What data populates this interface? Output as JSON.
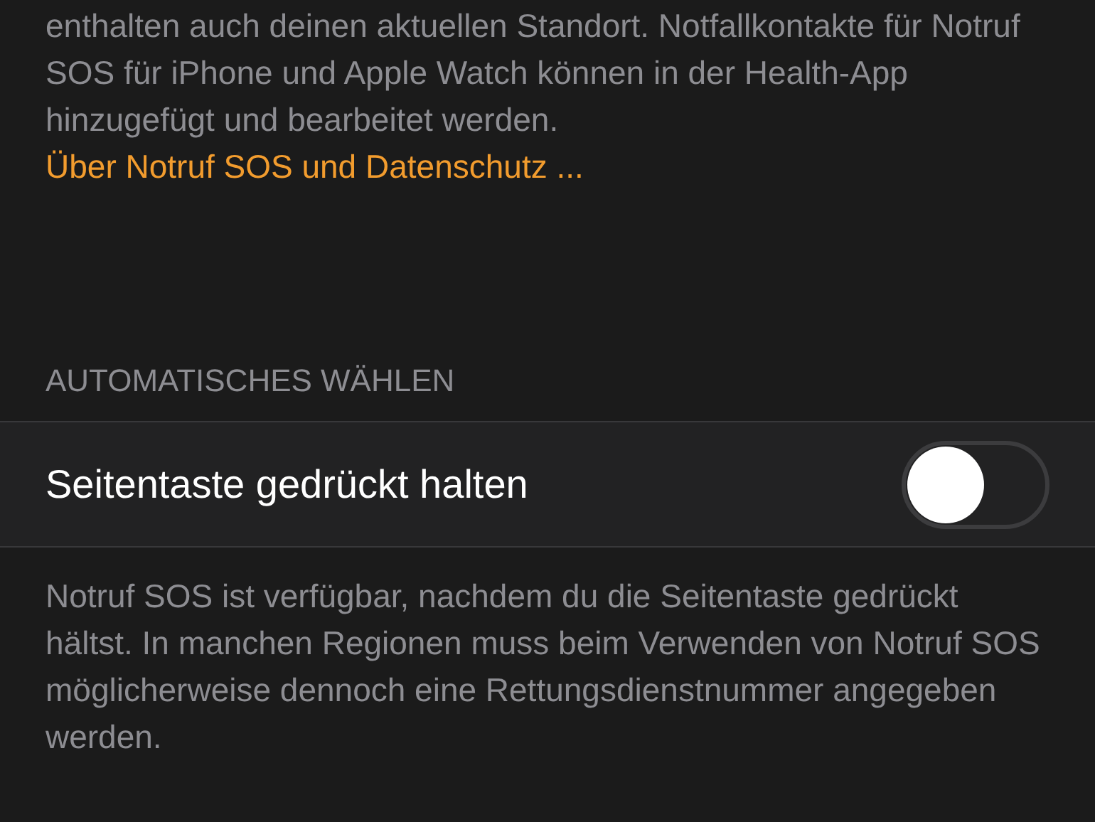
{
  "info_text": "enthalten auch deinen aktuellen Standort. Notfallkontakte für Notruf SOS für iPhone und Apple Watch können in der Health-App hinzugefügt und bearbeitet werden.",
  "info_link": "Über Notruf SOS und Datenschutz ...",
  "section_header": "AUTOMATISCHES WÄHLEN",
  "setting": {
    "label": "Seitentaste gedrückt halten",
    "on": false
  },
  "footer_text": "Notruf SOS ist verfügbar, nachdem du die Seitentaste gedrückt hältst. In manchen Regionen muss beim Verwenden von Notruf SOS möglicherweise dennoch eine Rettungsdienstnummer angegeben werden."
}
